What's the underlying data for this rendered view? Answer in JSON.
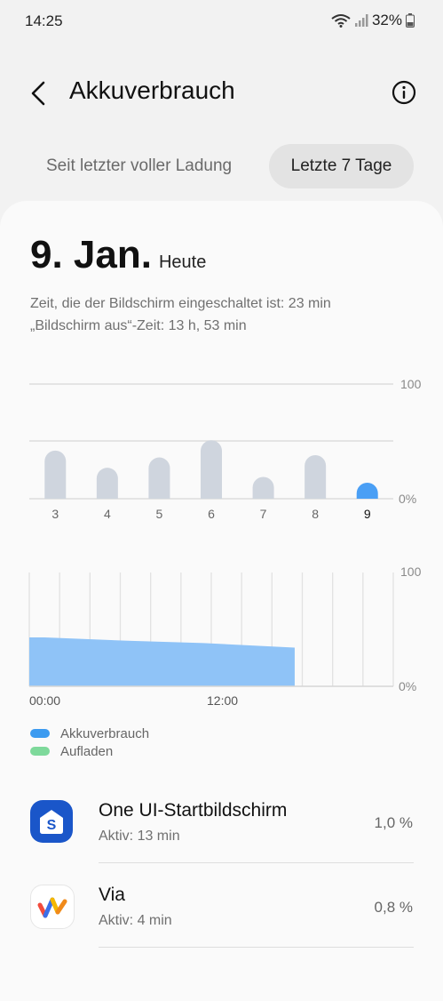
{
  "status_bar": {
    "time": "14:25",
    "battery_percent": "32%",
    "icons": [
      "wifi-icon",
      "signal-icon",
      "battery-icon"
    ]
  },
  "header": {
    "title": "Akkuverbrauch",
    "back_icon": "chevron-left-icon",
    "info_icon": "info-icon"
  },
  "tabs": [
    {
      "label": "Seit letzter voller Ladung",
      "selected": false
    },
    {
      "label": "Letzte 7 Tage",
      "selected": true
    }
  ],
  "summary": {
    "date": "9. Jan.",
    "date_sub": "Heute",
    "screen_on": "Zeit, die der Bildschirm eingeschaltet ist: 23 min",
    "screen_off": "„Bildschirm aus“-Zeit: 13 h, 53 min"
  },
  "chart_data": [
    {
      "type": "bar",
      "categories": [
        "3",
        "4",
        "5",
        "6",
        "7",
        "8",
        "9"
      ],
      "values": [
        42,
        27,
        36,
        51,
        19,
        38,
        14
      ],
      "selected_category": "9",
      "ylim": [
        0,
        100
      ],
      "y_tick_labels": [
        "100",
        "0%"
      ],
      "colors": {
        "default": "#cfd5de",
        "selected": "#4a9ff5"
      },
      "grid": true
    },
    {
      "type": "area",
      "x": [
        0,
        1,
        6.5,
        11.5,
        17.5,
        24
      ],
      "values": [
        43,
        43,
        40,
        38,
        34,
        null
      ],
      "xlim": [
        0,
        24
      ],
      "ylim": [
        0,
        100
      ],
      "x_tick_labels": [
        "00:00",
        "12:00"
      ],
      "y_tick_labels": [
        "100",
        "0%"
      ],
      "color": "#8fc3f7",
      "grid": true
    }
  ],
  "legend": [
    {
      "label": "Akkuverbrauch",
      "color": "#3c9bf0"
    },
    {
      "label": "Aufladen",
      "color": "#7ed99b"
    }
  ],
  "apps": [
    {
      "name": "One UI-Startbildschirm",
      "sub": "Aktiv: 13 min",
      "percent": "1,0 %",
      "icon": "one-ui-home-icon"
    },
    {
      "name": "Via",
      "sub": "Aktiv: 4 min",
      "percent": "0,8 %",
      "icon": "via-browser-icon"
    }
  ]
}
